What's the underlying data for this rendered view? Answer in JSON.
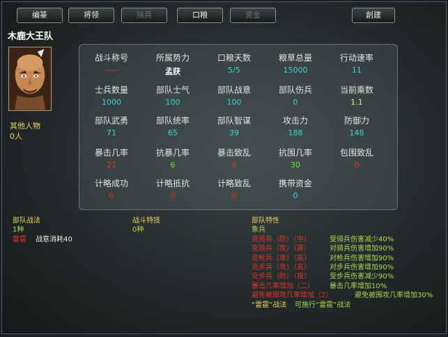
{
  "toolbar": {
    "btn1": "编篆",
    "btn2": "将领",
    "btn3": "除兵",
    "btn4": "口粮",
    "btn5": "资金",
    "btn6": "創建"
  },
  "unit_name": "木鹿大王队",
  "other_figures": {
    "label": "其他人物",
    "count": "0人"
  },
  "stats": [
    {
      "label": "战斗称号",
      "value": "——"
    },
    {
      "label": "所属势力",
      "value": "孟获"
    },
    {
      "label": "口粮天数",
      "value": "5/5"
    },
    {
      "label": "粮草总量",
      "value": "15000"
    },
    {
      "label": "行动速率",
      "value": "11"
    },
    {
      "label": "士兵数量",
      "value": "1000"
    },
    {
      "label": "部队士气",
      "value": "100"
    },
    {
      "label": "部队战意",
      "value": "100"
    },
    {
      "label": "部队伤兵",
      "value": "0"
    },
    {
      "label": "当前乘数",
      "value": "1.1"
    },
    {
      "label": "部队武勇",
      "value": "71"
    },
    {
      "label": "部队统率",
      "value": "65"
    },
    {
      "label": "部队智谋",
      "value": "39"
    },
    {
      "label": "攻击力",
      "value": "188"
    },
    {
      "label": "防御力",
      "value": "148"
    },
    {
      "label": "暴击几率",
      "value": "21"
    },
    {
      "label": "抗暴几率",
      "value": "6"
    },
    {
      "label": "暴击致乱",
      "value": "0"
    },
    {
      "label": "抗围几率",
      "value": "30"
    },
    {
      "label": "包围致乱",
      "value": "0"
    },
    {
      "label": "计略成功",
      "value": "0"
    },
    {
      "label": "计略抵抗",
      "value": "0"
    },
    {
      "label": "计略致乱",
      "value": "0"
    },
    {
      "label": "携带资金",
      "value": "0"
    }
  ],
  "tactics": {
    "title": "部队战法",
    "count": "1种",
    "name": "雷霆",
    "cost": "战意消耗40"
  },
  "skills": {
    "title": "战斗特技",
    "count": "0种"
  },
  "traits": {
    "title": "部队特性",
    "type": "象兵",
    "items": [
      {
        "name": "克骑兵（防）（中）",
        "desc": "受骑兵伤害减少40%"
      },
      {
        "name": "克骑兵（攻）（高）",
        "desc": "对骑兵伤害增加90%"
      },
      {
        "name": "克枪兵（攻）（高）",
        "desc": "对枪兵伤害增加90%"
      },
      {
        "name": "克步兵（攻）（高）",
        "desc": "对步兵伤害增加90%"
      },
      {
        "name": "克步兵（防）（极）",
        "desc": "受步兵伤害减少90%"
      },
      {
        "name": "暴击几率增加（二）",
        "desc": "暴击几率增加10%"
      },
      {
        "name": "避免被围攻几率增加（2）",
        "desc": "避免被围攻几率增加30%"
      },
      {
        "name": "“雷霆”战法",
        "desc": "可施行“雷霆”战法"
      }
    ]
  },
  "colors": {
    "label": "#e4e4e4",
    "value_cyan": "#3fd0d8",
    "value_yellow": "#e8e070",
    "value_red": "#e0342a",
    "value_green": "#7ad84a",
    "faction": "#ffffff"
  }
}
